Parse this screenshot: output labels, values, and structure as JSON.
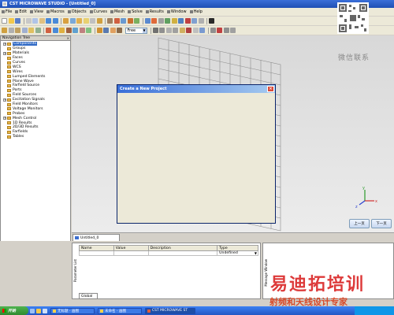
{
  "window": {
    "title": "CST MICROWAVE STUDIO - [Untitled_0]"
  },
  "menu": [
    "File",
    "Edit",
    "View",
    "Macros",
    "Objects",
    "Curves",
    "Mesh",
    "Solve",
    "Results",
    "Window",
    "Help"
  ],
  "toolbar": {
    "combo_value": "Free"
  },
  "nav_tree": {
    "title": "Navigation Tree",
    "close": "×",
    "items": [
      {
        "label": "Components",
        "selected": true
      },
      {
        "label": "Groups"
      },
      {
        "label": "Materials"
      },
      {
        "label": "Faces"
      },
      {
        "label": "Curves"
      },
      {
        "label": "WCS"
      },
      {
        "label": "Wires"
      },
      {
        "label": "Lumped Elements"
      },
      {
        "label": "Plane Wave"
      },
      {
        "label": "Farfield Source"
      },
      {
        "label": "Ports"
      },
      {
        "label": "Field Sources"
      },
      {
        "label": "Excitation Signals"
      },
      {
        "label": "Field Monitors"
      },
      {
        "label": "Voltage Monitors"
      },
      {
        "label": "Probes"
      },
      {
        "label": "Mesh Control"
      },
      {
        "label": "1D Results"
      },
      {
        "label": "2D/3D Results"
      },
      {
        "label": "Farfields"
      },
      {
        "label": "Tables"
      }
    ]
  },
  "viewport": {
    "tab_label": "Untitled_0",
    "axes": {
      "x": "x",
      "y": "y",
      "z": "z"
    },
    "buttons": [
      "上一页",
      "下一页"
    ]
  },
  "dialog": {
    "title": "Create a New Project",
    "close": "×"
  },
  "params": {
    "side_label": "Parameter List",
    "headers": [
      "Name",
      "Value",
      "Description",
      "Type"
    ],
    "row_type": "Undefined",
    "tab_label": "Global"
  },
  "messages": {
    "side_label": "Message Window"
  },
  "taskbar": {
    "start": "开始",
    "tasks": [
      "无标题 - 画图",
      "未命名 - 画图",
      "CST MICROWAVE ST"
    ]
  },
  "watermark": {
    "wechat": "微信联系",
    "brand": "易迪拓培训",
    "slogan": "射频和天线设计专家"
  }
}
